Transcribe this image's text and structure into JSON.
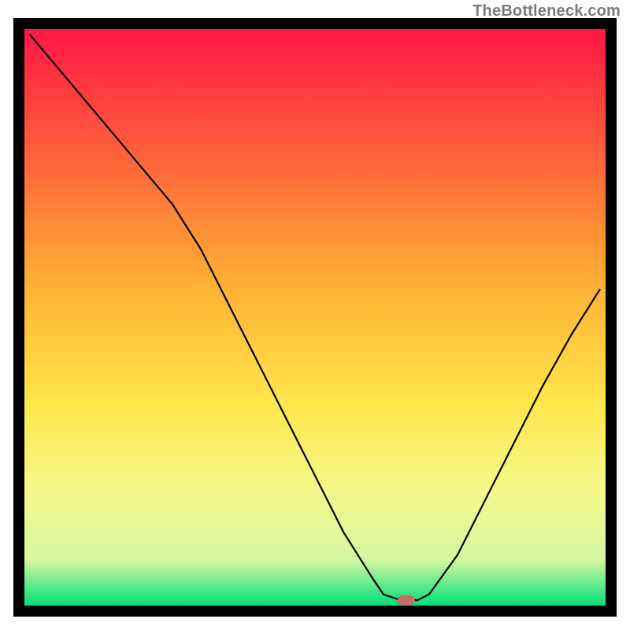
{
  "watermark": "TheBottleneck.com",
  "chart_data": {
    "type": "line",
    "title": "",
    "xlabel": "",
    "ylabel": "",
    "xlim": [
      0,
      100
    ],
    "ylim": [
      0,
      100
    ],
    "grid": false,
    "legend": false,
    "series": [
      {
        "name": "bottleneck-curve",
        "x": [
          0,
          5,
          10,
          15,
          20,
          25,
          30,
          35,
          40,
          45,
          50,
          55,
          60,
          62,
          65,
          68,
          70,
          75,
          80,
          85,
          90,
          95,
          100
        ],
        "values": [
          100,
          94,
          88,
          82,
          76,
          70,
          62,
          52,
          42,
          32,
          22,
          12,
          4,
          1,
          0,
          0,
          1,
          8,
          18,
          28,
          38,
          47,
          55
        ]
      }
    ],
    "marker": {
      "x": 66,
      "y": 0,
      "color": "#c96b6b"
    },
    "background_gradient": {
      "stops": [
        {
          "pct": 0,
          "color": "#ff1744"
        },
        {
          "pct": 20,
          "color": "#ff5a3c"
        },
        {
          "pct": 45,
          "color": "#ffb233"
        },
        {
          "pct": 65,
          "color": "#ffe74c"
        },
        {
          "pct": 80,
          "color": "#f4f88a"
        },
        {
          "pct": 92,
          "color": "#d6f7a0"
        },
        {
          "pct": 100,
          "color": "#00e07a"
        }
      ]
    },
    "frame_color": "#000000"
  }
}
